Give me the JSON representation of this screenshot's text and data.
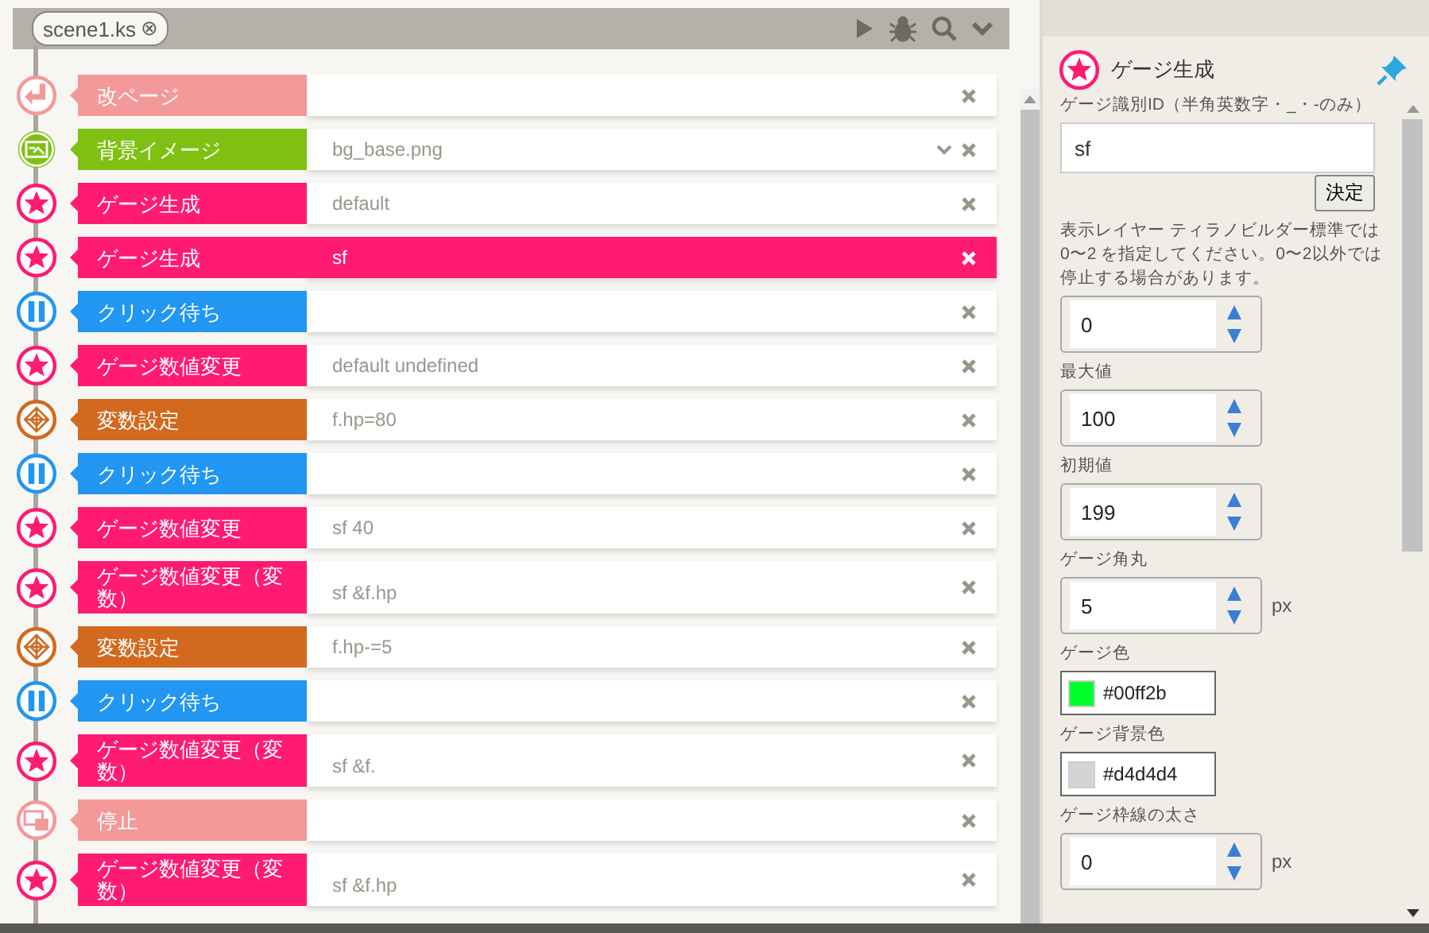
{
  "tab": {
    "label": "scene1.ks",
    "close": "⊗"
  },
  "rows": [
    {
      "kind": "newpage",
      "label": "改ページ",
      "selected": false,
      "dropdown": false
    },
    {
      "kind": "bg",
      "label": "背景イメージ",
      "value": "bg_base.png",
      "selected": false,
      "dropdown": true
    },
    {
      "kind": "gauge",
      "label": "ゲージ生成",
      "value": "default",
      "selected": false,
      "dropdown": false
    },
    {
      "kind": "gauge",
      "label": "ゲージ生成",
      "value": "sf",
      "selected": true,
      "dropdown": false
    },
    {
      "kind": "wait",
      "label": "クリック待ち",
      "selected": false,
      "dropdown": false
    },
    {
      "kind": "gauge",
      "label": "ゲージ数値変更",
      "value": "default undefined",
      "selected": false,
      "dropdown": false
    },
    {
      "kind": "var",
      "label": "変数設定",
      "value": "f.hp=80",
      "selected": false,
      "dropdown": false
    },
    {
      "kind": "wait",
      "label": "クリック待ち",
      "selected": false,
      "dropdown": false
    },
    {
      "kind": "gauge",
      "label": "ゲージ数値変更",
      "value": "sf 40",
      "selected": false,
      "dropdown": false
    },
    {
      "kind": "gauge",
      "label": "ゲージ数値変更（変数）",
      "value": "sf &f.hp",
      "selected": false,
      "dropdown": false
    },
    {
      "kind": "var",
      "label": "変数設定",
      "value": "f.hp-=5",
      "selected": false,
      "dropdown": false
    },
    {
      "kind": "wait",
      "label": "クリック待ち",
      "selected": false,
      "dropdown": false
    },
    {
      "kind": "gauge",
      "label": "ゲージ数値変更（変数）",
      "value": "sf &f.",
      "selected": false,
      "dropdown": false
    },
    {
      "kind": "stop",
      "label": "停止",
      "selected": false,
      "dropdown": false
    },
    {
      "kind": "gauge",
      "label": "ゲージ数値変更（変数）",
      "value": "sf &f.hp",
      "selected": false,
      "dropdown": false
    }
  ],
  "panel": {
    "title": "ゲージ生成",
    "fields": [
      {
        "kind": "text",
        "label": "ゲージ識別ID（半角英数字・_・-のみ）",
        "value": "sf",
        "button": "決定"
      },
      {
        "kind": "number",
        "label": "表示レイヤー ティラノビルダー標準では0〜2 を指定してください。0〜2以外では停止する場合があります。",
        "value": "0"
      },
      {
        "kind": "number",
        "label": "最大値",
        "value": "100"
      },
      {
        "kind": "number",
        "label": "初期値",
        "value": "199"
      },
      {
        "kind": "number",
        "label": "ゲージ角丸",
        "value": "5",
        "unit": "px"
      },
      {
        "kind": "color",
        "label": "ゲージ色",
        "value": "#00ff2b",
        "color": "#00ff2b"
      },
      {
        "kind": "color",
        "label": "ゲージ背景色",
        "value": "#d4d4d4",
        "color": "#d4d4d4"
      },
      {
        "kind": "number",
        "label": "ゲージ枠線の太さ",
        "value": "0",
        "unit": "px"
      }
    ]
  }
}
